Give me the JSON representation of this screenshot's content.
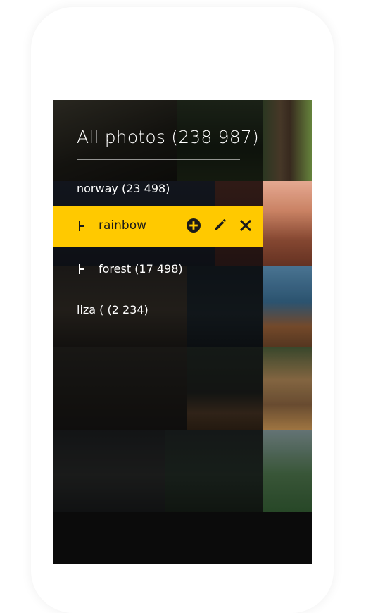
{
  "gallery": {
    "title": "All photos (238 987)"
  },
  "albums": [
    {
      "label": "norway (23 498)"
    },
    {
      "label": "rainbow"
    },
    {
      "label": "forest  (17 498)"
    },
    {
      "label": "liza ( (2 234)"
    }
  ],
  "colors": {
    "accent": "#ffc900",
    "background": "#0a0a0a"
  },
  "icons": {
    "add": "plus-circle-icon",
    "edit": "pencil-icon",
    "delete": "close-icon",
    "tree": "tee-branch-icon"
  }
}
